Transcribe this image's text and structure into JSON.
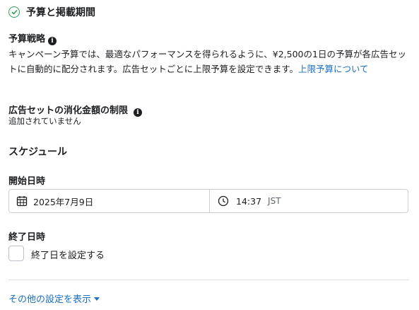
{
  "section": {
    "title": "予算と掲載期間"
  },
  "budget_strategy": {
    "label": "予算戦略",
    "description": "キャンペーン予算では、最適なパフォーマンスを得られるように、¥2,500の1日の予算が各広告セットに自動的に配分されます。広告セットごとに上限予算を設定できます。",
    "link": "上限予算について"
  },
  "spend_limit": {
    "label": "広告セットの消化金額の制限",
    "value": "追加されていません"
  },
  "schedule": {
    "title": "スケジュール",
    "start_label": "開始日時",
    "start_date": "2025年7月9日",
    "start_time": "14:37",
    "timezone": "JST",
    "end_label": "終了日時",
    "end_checkbox_label": "終了日を設定する"
  },
  "more_settings": "その他の設定を表示",
  "colors": {
    "accent": "#1a6fc4",
    "success": "#2f9e5a"
  },
  "icons": [
    "check-circle-icon",
    "info-icon",
    "calendar-icon",
    "clock-icon",
    "caret-down-icon"
  ]
}
